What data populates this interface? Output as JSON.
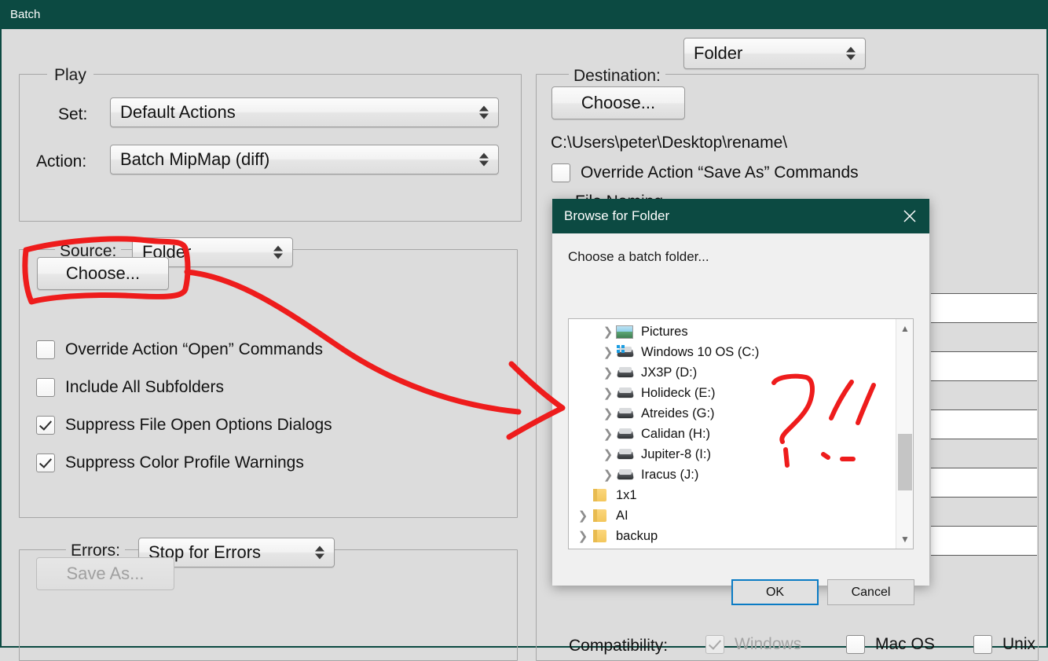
{
  "window": {
    "title": "Batch",
    "titlebar_color": "#0c4a42",
    "background_color": "#dcdcdc"
  },
  "play_group": {
    "legend": "Play",
    "set_label": "Set:",
    "set_value": "Default Actions",
    "action_label": "Action:",
    "action_value": "Batch MipMap (diff)"
  },
  "source_group": {
    "legend_label": "Source:",
    "source_value": "Folder",
    "choose_label": "Choose...",
    "checkboxes": [
      {
        "label": "Override Action “Open” Commands",
        "checked": false
      },
      {
        "label": "Include All Subfolders",
        "checked": false
      },
      {
        "label": "Suppress File Open Options Dialogs",
        "checked": true
      },
      {
        "label": "Suppress Color Profile Warnings",
        "checked": true
      }
    ]
  },
  "errors_group": {
    "legend_label": "Errors:",
    "errors_value": "Stop for Errors",
    "save_as_label": "Save As...",
    "save_as_disabled": true
  },
  "destination_group": {
    "legend_label": "Destination:",
    "destination_value": "Folder",
    "choose_label": "Choose...",
    "path_text": "C:\\Users\\peter\\Desktop\\rename\\",
    "override_save_as": {
      "label": "Override Action “Save As” Commands",
      "checked": false
    },
    "file_naming_label": "File Naming",
    "compatibility_label": "Compatibility:",
    "compatibility": [
      {
        "label": "Windows",
        "checked": true,
        "disabled": true
      },
      {
        "label": "Mac OS",
        "checked": false,
        "disabled": false
      },
      {
        "label": "Unix",
        "checked": false,
        "disabled": false
      }
    ]
  },
  "browse_dialog": {
    "title": "Browse for Folder",
    "close_icon": "close-icon",
    "prompt": "Choose a batch folder...",
    "tree_items": [
      {
        "label": "Pictures",
        "icon": "pictures-icon",
        "indent": 2,
        "expandable": true
      },
      {
        "label": "Windows 10 OS (C:)",
        "icon": "windows-drive-icon",
        "indent": 2,
        "expandable": true
      },
      {
        "label": "JX3P (D:)",
        "icon": "drive-icon",
        "indent": 2,
        "expandable": true
      },
      {
        "label": "Holideck (E:)",
        "icon": "drive-icon",
        "indent": 2,
        "expandable": true
      },
      {
        "label": "Atreides (G:)",
        "icon": "drive-icon",
        "indent": 2,
        "expandable": true
      },
      {
        "label": "Calidan (H:)",
        "icon": "drive-icon",
        "indent": 2,
        "expandable": true
      },
      {
        "label": "Jupiter-8 (I:)",
        "icon": "drive-icon",
        "indent": 2,
        "expandable": true
      },
      {
        "label": "Iracus (J:)",
        "icon": "drive-icon",
        "indent": 2,
        "expandable": true
      },
      {
        "label": "1x1",
        "icon": "folder-icon",
        "indent": 1,
        "expandable": false
      },
      {
        "label": "AI",
        "icon": "folder-icon",
        "indent": 1,
        "expandable": true
      },
      {
        "label": "backup",
        "icon": "folder-icon",
        "indent": 1,
        "expandable": true
      }
    ],
    "ok_label": "OK",
    "cancel_label": "Cancel",
    "scrollbar": {
      "up_arrow": "chevron-up-icon",
      "down_arrow": "chevron-down-icon"
    }
  },
  "annotations": {
    "ink_color": "#ee1c1c",
    "marks": [
      "rectangle-around-source-choose-button",
      "arrow-from-choose-to-browse-dialog",
      "question-exclamation-scribble-in-dialog"
    ]
  }
}
